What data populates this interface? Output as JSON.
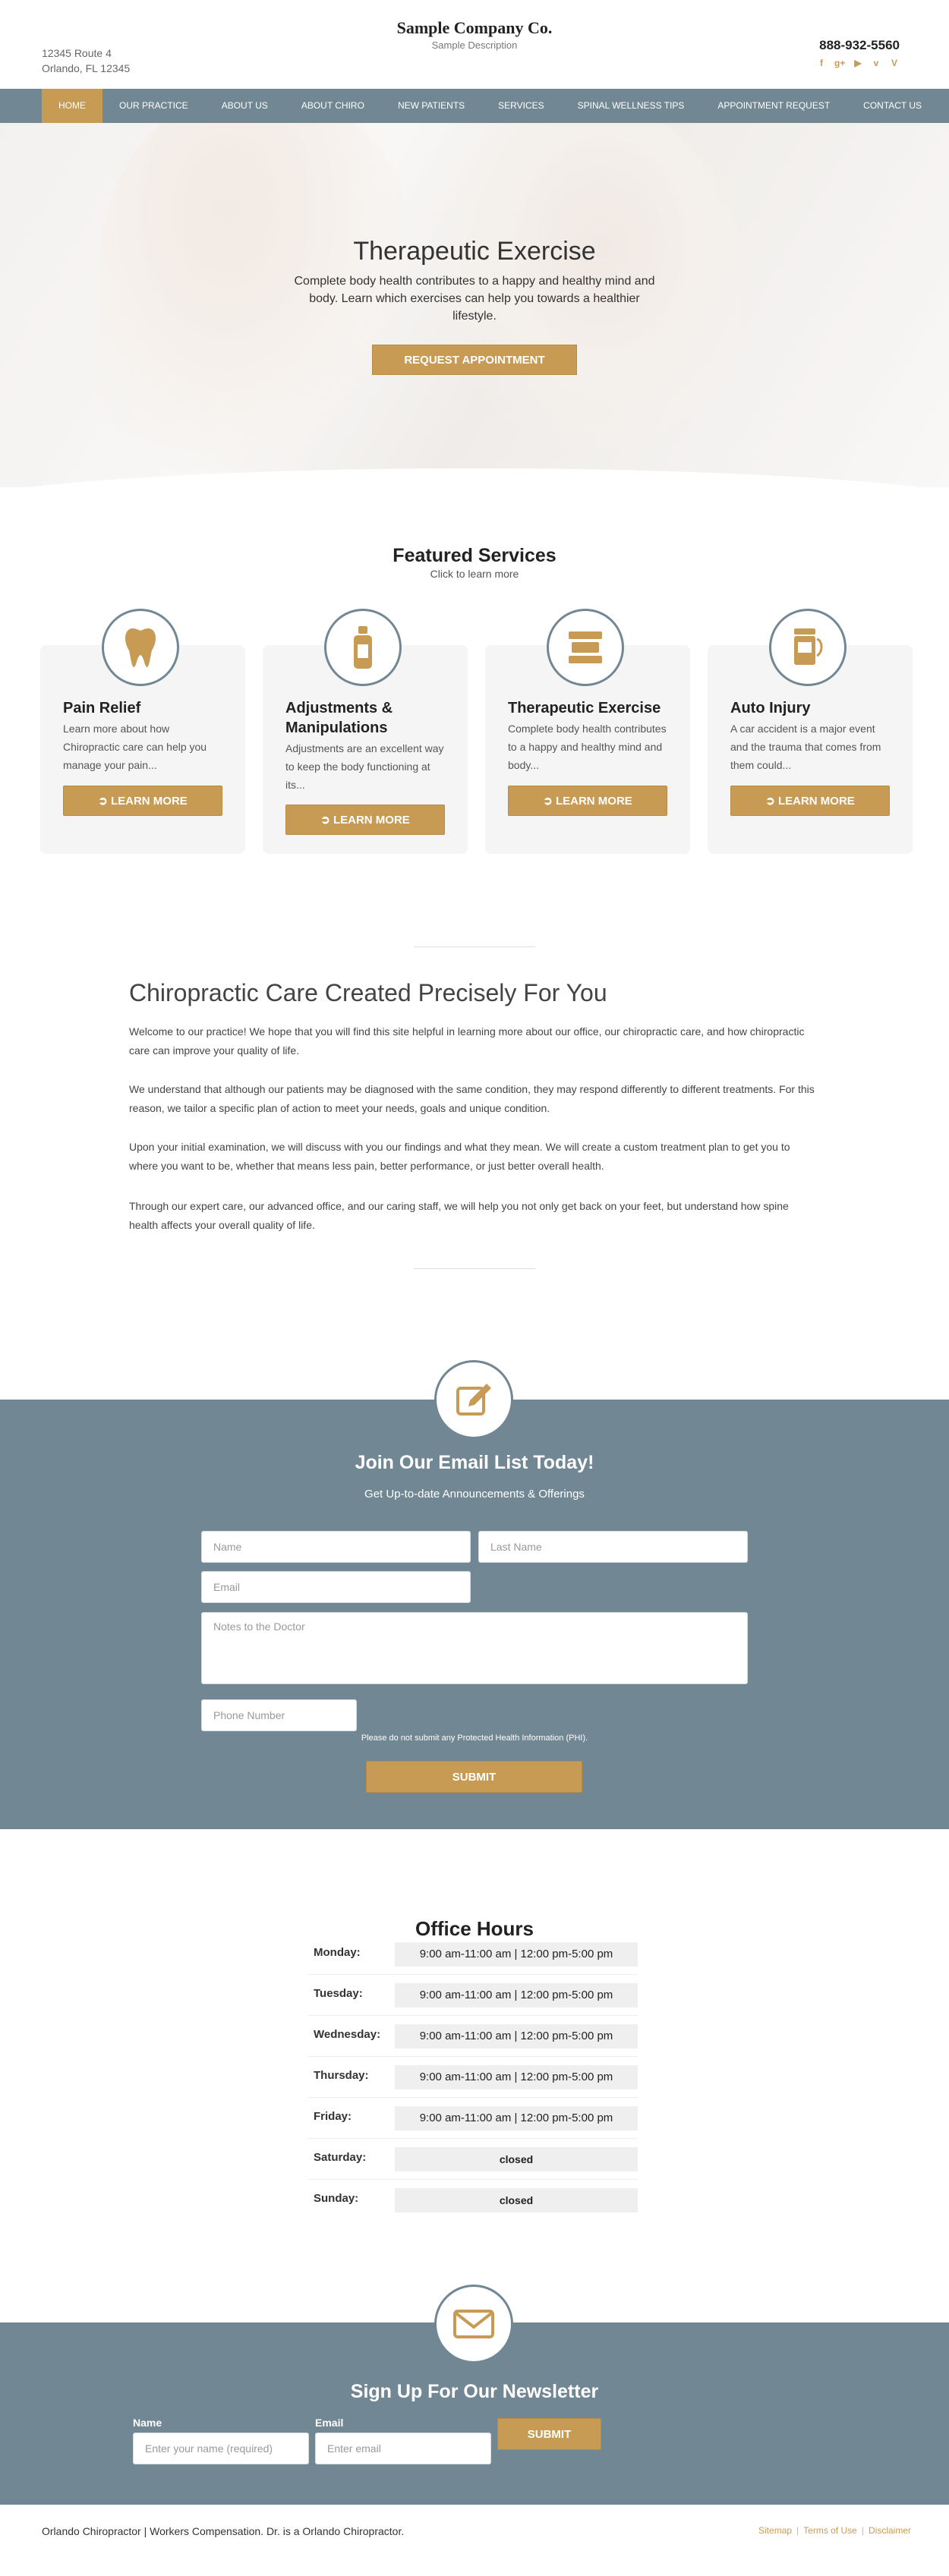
{
  "header": {
    "company": "Sample Company Co.",
    "description": "Sample Description",
    "address_line1": "12345 Route 4",
    "address_line2": "Orlando, FL 12345",
    "phone": "888-932-5560",
    "social_icons": [
      "facebook-icon",
      "google-plus-icon",
      "youtube-icon",
      "vimeo-icon",
      "vine-icon"
    ]
  },
  "nav": {
    "items": [
      "HOME",
      "OUR PRACTICE",
      "ABOUT US",
      "ABOUT CHIRO",
      "NEW PATIENTS",
      "SERVICES",
      "SPINAL WELLNESS TIPS",
      "APPOINTMENT REQUEST",
      "CONTACT US"
    ],
    "active": "HOME"
  },
  "hero": {
    "title": "Therapeutic Exercise",
    "text": "Complete body health contributes to a happy and healthy mind and body. Learn which exercises can help you towards a healthier lifestyle.",
    "button": "REQUEST APPOINTMENT"
  },
  "featured": {
    "title": "Featured Services",
    "subtitle": "Click to learn more",
    "cards": [
      {
        "icon": "tooth-icon",
        "title": "Pain Relief",
        "text": "Learn more about how Chiropractic care can help you manage your pain...",
        "button": "LEARN MORE"
      },
      {
        "icon": "bottle-icon",
        "title": "Adjustments & Manipulations",
        "text": "Adjustments are an excellent way to keep the body functioning at its...",
        "button": "LEARN MORE"
      },
      {
        "icon": "exercise-icon",
        "title": "Therapeutic Exercise",
        "text": "Complete body health contributes to a happy and healthy mind and body...",
        "button": "LEARN MORE"
      },
      {
        "icon": "mouthwash-icon",
        "title": "Auto Injury",
        "text": "A car accident is a major event and the trauma that comes from them could...",
        "button": "LEARN MORE"
      }
    ]
  },
  "content": {
    "title": "Chiropractic Care Created Precisely For You",
    "paragraphs": [
      "Welcome to our practice! We hope that you will find this site helpful in learning more about our office, our chiropractic care, and how chiropractic care can improve your quality of life.",
      "We understand that although our patients may be diagnosed with the same condition, they may respond differently to different treatments. For this reason, we tailor a specific plan of action to meet your needs, goals and unique condition.",
      "Upon your initial examination, we will discuss with you our findings and what they mean. We will create a custom treatment plan to get you to where you want to be, whether that means less pain, better performance, or just better overall health.",
      "Through our expert care, our advanced office, and our caring staff, we will help you not only get back on your feet, but understand how spine health affects your overall quality of life."
    ]
  },
  "email_form": {
    "icon": "edit-icon",
    "title": "Join Our Email List Today!",
    "subtitle": "Get Up-to-date Announcements & Offerings",
    "name_placeholder": "Name",
    "last_name_placeholder": "Last Name",
    "email_placeholder": "Email",
    "notes_placeholder": "Notes to the Doctor",
    "phone_placeholder": "Phone Number",
    "phi_notice": "Please do not submit any Protected Health Information (PHI).",
    "submit": "SUBMIT"
  },
  "hours": {
    "title": "Office Hours",
    "rows": [
      {
        "day": "Monday:",
        "times": "9:00 am-11:00 am   |   12:00 pm-5:00 pm"
      },
      {
        "day": "Tuesday:",
        "times": "9:00 am-11:00 am   |   12:00 pm-5:00 pm"
      },
      {
        "day": "Wednesday:",
        "times": "9:00 am-11:00 am   |   12:00 pm-5:00 pm"
      },
      {
        "day": "Thursday:",
        "times": "9:00 am-11:00 am   |   12:00 pm-5:00 pm"
      },
      {
        "day": "Friday:",
        "times": "9:00 am-11:00 am   |   12:00 pm-5:00 pm"
      },
      {
        "day": "Saturday:",
        "times": "closed"
      },
      {
        "day": "Sunday:",
        "times": "closed"
      }
    ]
  },
  "newsletter": {
    "icon": "envelope-icon",
    "title": "Sign Up For Our Newsletter",
    "name_label": "Name",
    "name_placeholder": "Enter your name (required)",
    "email_label": "Email",
    "email_placeholder": "Enter email",
    "submit": "SUBMIT"
  },
  "footer": {
    "text": "Orlando Chiropractor | Workers Compensation. Dr. is a Orlando Chiropractor.",
    "links": [
      "Sitemap",
      "Terms of Use",
      "Disclaimer"
    ]
  },
  "colors": {
    "accent": "#c89b54",
    "band": "#728794"
  }
}
